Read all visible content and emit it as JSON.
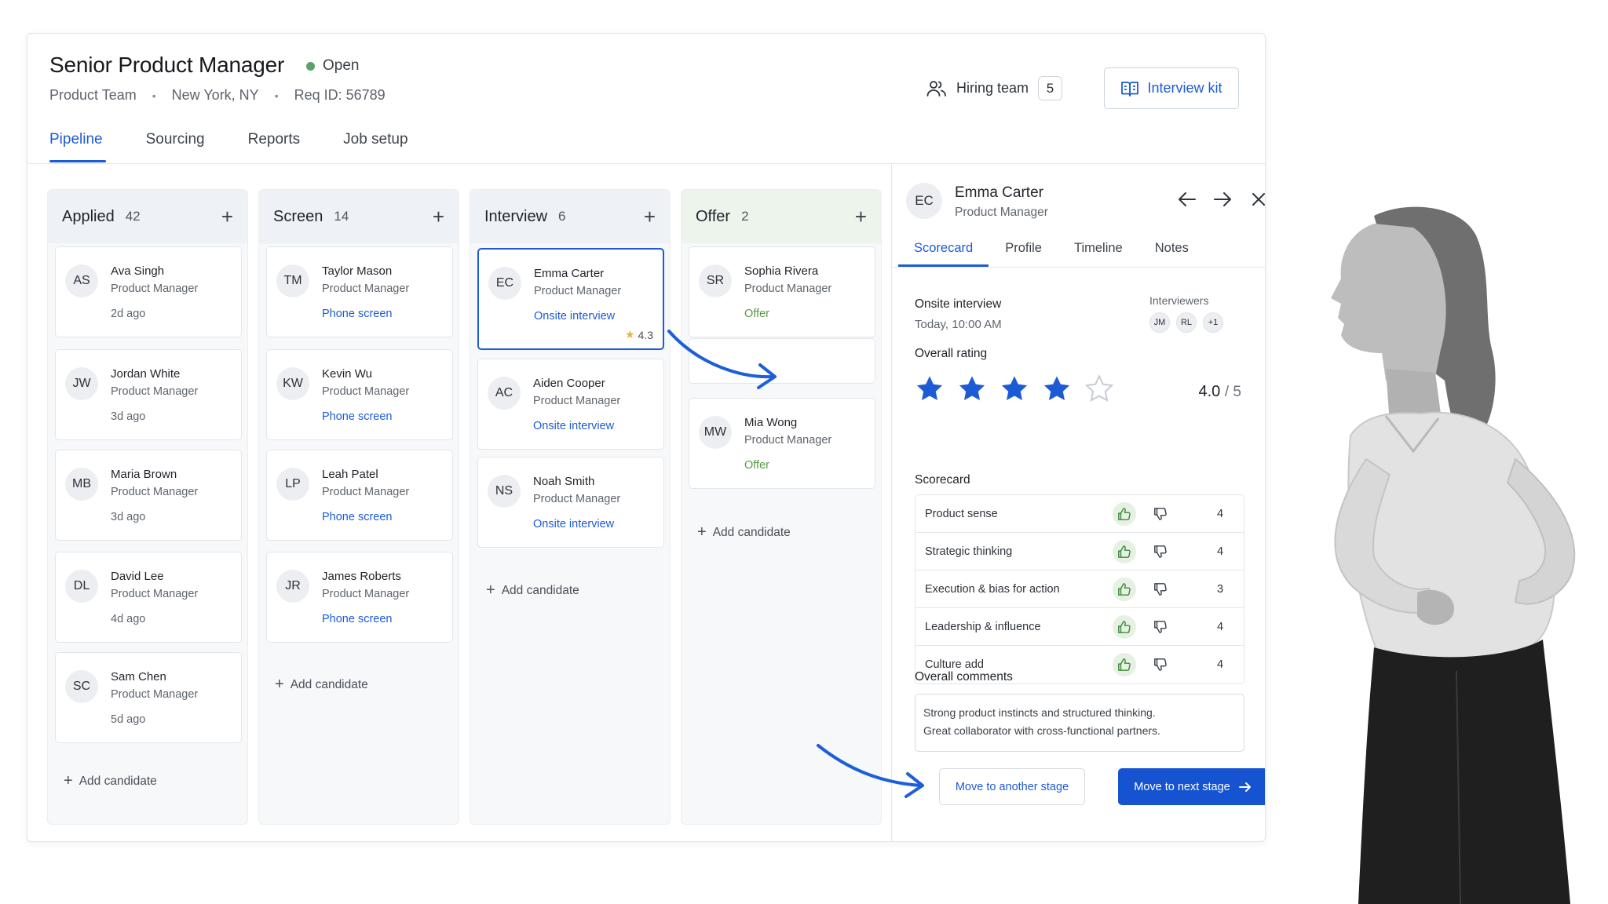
{
  "job": {
    "title": "Senior Product Manager",
    "status": "Open",
    "team": "Product Team",
    "location": "New York, NY",
    "req_id": "Req ID: 56789",
    "separator": "•"
  },
  "header_actions": {
    "hiring_team_label": "Hiring team",
    "hiring_team_count": "5",
    "interview_kit_label": "Interview kit"
  },
  "tabs": [
    {
      "label": "Pipeline",
      "active": true
    },
    {
      "label": "Sourcing",
      "active": false
    },
    {
      "label": "Reports",
      "active": false
    },
    {
      "label": "Job setup",
      "active": false
    }
  ],
  "columns": [
    {
      "title": "Applied",
      "count": "42",
      "add_label": "Add candidate",
      "cards": [
        {
          "initials": "AS",
          "name": "Ava Singh",
          "role": "Product Manager",
          "foot": "2d ago"
        },
        {
          "initials": "JW",
          "name": "Jordan White",
          "role": "Product Manager",
          "foot": "3d ago"
        },
        {
          "initials": "MB",
          "name": "Maria Brown",
          "role": "Product Manager",
          "foot": "3d ago"
        },
        {
          "initials": "DL",
          "name": "David Lee",
          "role": "Product Manager",
          "foot": "4d ago"
        },
        {
          "initials": "SC",
          "name": "Sam Chen",
          "role": "Product Manager",
          "foot": "5d ago"
        }
      ]
    },
    {
      "title": "Screen",
      "count": "14",
      "add_label": "Add candidate",
      "cards": [
        {
          "initials": "TM",
          "name": "Taylor Mason",
          "role": "Product Manager",
          "foot": "Phone screen"
        },
        {
          "initials": "KW",
          "name": "Kevin Wu",
          "role": "Product Manager",
          "foot": "Phone screen"
        },
        {
          "initials": "LP",
          "name": "Leah Patel",
          "role": "Product Manager",
          "foot": "Phone screen"
        },
        {
          "initials": "JR",
          "name": "James Roberts",
          "role": "Product Manager",
          "foot": "Phone screen"
        }
      ]
    },
    {
      "title": "Interview",
      "count": "6",
      "add_label": "Add candidate",
      "cards": [
        {
          "initials": "EC",
          "name": "Emma Carter",
          "role": "Product Manager",
          "foot": "Onsite interview",
          "rating": "4.3"
        },
        {
          "initials": "AC",
          "name": "Aiden Cooper",
          "role": "Product Manager",
          "foot": "Onsite interview"
        },
        {
          "initials": "NS",
          "name": "Noah Smith",
          "role": "Product Manager",
          "foot": "Onsite interview"
        }
      ]
    },
    {
      "title": "Offer",
      "count": "2",
      "add_label": "Add candidate",
      "cards": [
        {
          "initials": "SR",
          "name": "Sophia Rivera",
          "role": "Product Manager",
          "foot": "Offer"
        },
        {
          "initials": "MW",
          "name": "Mia Wong",
          "role": "Product Manager",
          "foot": "Offer"
        }
      ]
    }
  ],
  "panel": {
    "initials": "EC",
    "name": "Emma Carter",
    "role": "Product Manager",
    "tabs": [
      {
        "label": "Scorecard",
        "active": true
      },
      {
        "label": "Profile",
        "active": false
      },
      {
        "label": "Timeline",
        "active": false
      },
      {
        "label": "Notes",
        "active": false
      }
    ],
    "interview_title": "Onsite interview",
    "interview_time": "Today, 10:00 AM",
    "interviewers_label": "Interviewers",
    "interviewers": [
      "JM",
      "RL",
      "+1"
    ],
    "overall_rating_label": "Overall rating",
    "rating_stars": 4,
    "rating_max": 5,
    "rating_value": "4.0",
    "rating_suffix": "/ 5",
    "scorecard_label": "Scorecard",
    "scorecard": [
      {
        "label": "Product sense",
        "score": "4"
      },
      {
        "label": "Strategic thinking",
        "score": "4"
      },
      {
        "label": "Execution & bias for action",
        "score": "3"
      },
      {
        "label": "Leadership & influence",
        "score": "4"
      },
      {
        "label": "Culture add",
        "score": "4"
      }
    ],
    "comments_label": "Overall comments",
    "comments_line1": "Strong product instincts and structured thinking.",
    "comments_line2": "Great collaborator with cross-functional partners.",
    "move_other_label": "Move to another stage",
    "move_next_label": "Move to next stage"
  },
  "colors": {
    "accent": "#1d5bd6",
    "primary_button": "#1553d1",
    "status_open": "#58a36b",
    "offer_green": "#5a9a45",
    "star_gold": "#e4b541"
  },
  "icons": {
    "hiring_team": "people-icon",
    "interview_kit": "book-icon",
    "prev": "arrow-left-icon",
    "next": "arrow-right-icon",
    "close": "close-icon",
    "thumb_up": "thumbs-up-icon",
    "thumb_down": "thumbs-down-icon"
  }
}
